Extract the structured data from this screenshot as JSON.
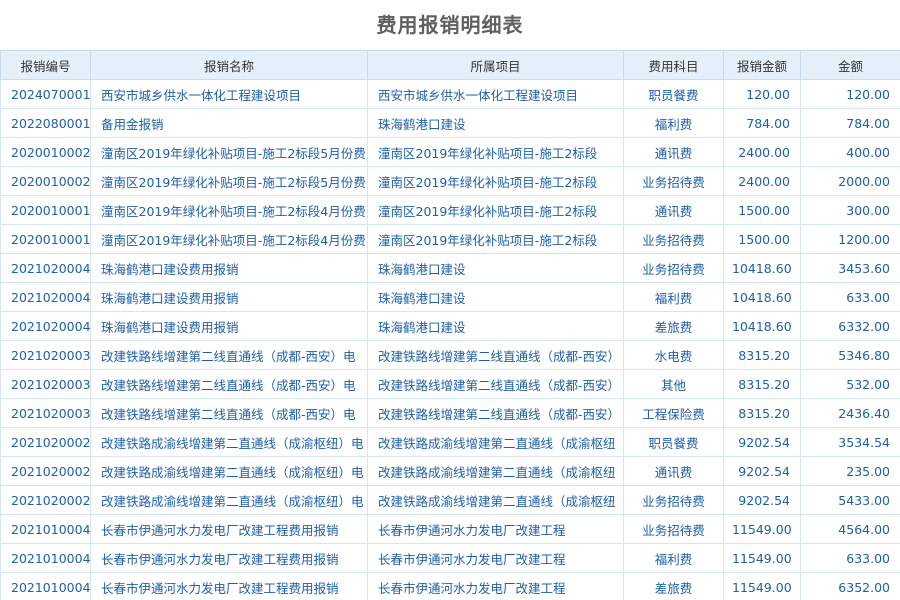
{
  "title": "费用报销明细表",
  "columns": [
    "报销编号",
    "报销名称",
    "所属项目",
    "费用科目",
    "报销金额",
    "金额"
  ],
  "rows": [
    [
      "2024070001",
      "西安市城乡供水一体化工程建设项目",
      "西安市城乡供水一体化工程建设项目",
      "职员餐费",
      "120.00",
      "120.00"
    ],
    [
      "2022080001",
      "备用金报销",
      "珠海鹤港口建设",
      "福利费",
      "784.00",
      "784.00"
    ],
    [
      "2020010002",
      "潼南区2019年绿化补贴项目-施工2标段5月份费",
      "潼南区2019年绿化补贴项目-施工2标段",
      "通讯费",
      "2400.00",
      "400.00"
    ],
    [
      "2020010002",
      "潼南区2019年绿化补贴项目-施工2标段5月份费",
      "潼南区2019年绿化补贴项目-施工2标段",
      "业务招待费",
      "2400.00",
      "2000.00"
    ],
    [
      "2020010001",
      "潼南区2019年绿化补贴项目-施工2标段4月份费",
      "潼南区2019年绿化补贴项目-施工2标段",
      "通讯费",
      "1500.00",
      "300.00"
    ],
    [
      "2020010001",
      "潼南区2019年绿化补贴项目-施工2标段4月份费",
      "潼南区2019年绿化补贴项目-施工2标段",
      "业务招待费",
      "1500.00",
      "1200.00"
    ],
    [
      "2021020004",
      "珠海鹤港口建设费用报销",
      "珠海鹤港口建设",
      "业务招待费",
      "10418.60",
      "3453.60"
    ],
    [
      "2021020004",
      "珠海鹤港口建设费用报销",
      "珠海鹤港口建设",
      "福利费",
      "10418.60",
      "633.00"
    ],
    [
      "2021020004",
      "珠海鹤港口建设费用报销",
      "珠海鹤港口建设",
      "差旅费",
      "10418.60",
      "6332.00"
    ],
    [
      "2021020003",
      "改建铁路线增建第二线直通线（成都-西安）电",
      "改建铁路线增建第二线直通线（成都-西安）",
      "水电费",
      "8315.20",
      "5346.80"
    ],
    [
      "2021020003",
      "改建铁路线增建第二线直通线（成都-西安）电",
      "改建铁路线增建第二线直通线（成都-西安）",
      "其他",
      "8315.20",
      "532.00"
    ],
    [
      "2021020003",
      "改建铁路线增建第二线直通线（成都-西安）电",
      "改建铁路线增建第二线直通线（成都-西安）",
      "工程保险费",
      "8315.20",
      "2436.40"
    ],
    [
      "2021020002",
      "改建铁路成渝线增建第二直通线（成渝枢纽）电",
      "改建铁路成渝线增建第二直通线（成渝枢纽",
      "职员餐费",
      "9202.54",
      "3534.54"
    ],
    [
      "2021020002",
      "改建铁路成渝线增建第二直通线（成渝枢纽）电",
      "改建铁路成渝线增建第二直通线（成渝枢纽",
      "通讯费",
      "9202.54",
      "235.00"
    ],
    [
      "2021020002",
      "改建铁路成渝线增建第二直通线（成渝枢纽）电",
      "改建铁路成渝线增建第二直通线（成渝枢纽",
      "业务招待费",
      "9202.54",
      "5433.00"
    ],
    [
      "2021010004",
      "长春市伊通河水力发电厂改建工程费用报销",
      "长春市伊通河水力发电厂改建工程",
      "业务招待费",
      "11549.00",
      "4564.00"
    ],
    [
      "2021010004",
      "长春市伊通河水力发电厂改建工程费用报销",
      "长春市伊通河水力发电厂改建工程",
      "福利费",
      "11549.00",
      "633.00"
    ],
    [
      "2021010004",
      "长春市伊通河水力发电厂改建工程费用报销",
      "长春市伊通河水力发电厂改建工程",
      "差旅费",
      "11549.00",
      "6352.00"
    ]
  ]
}
